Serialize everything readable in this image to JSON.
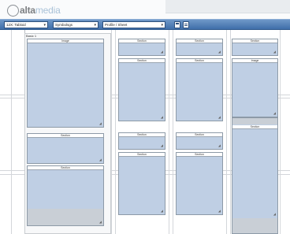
{
  "app": {
    "logo_part1": "alta",
    "logo_part2": "media"
  },
  "toolbar": {
    "dropdowns": [
      {
        "label": "12X: Tabloid"
      },
      {
        "label": "Symbolsgs"
      },
      {
        "label": "Profile / Sheet"
      }
    ],
    "icons": [
      "save-icon",
      "document-icon"
    ]
  },
  "canvas": {
    "page_label": "Basic 1",
    "panels": [
      {
        "title": "Image"
      },
      {
        "title": "Section"
      },
      {
        "title": "Section"
      },
      {
        "title": "Section"
      },
      {
        "title": "Section"
      },
      {
        "title": "Section"
      },
      {
        "title": "Section"
      },
      {
        "title": "Section"
      },
      {
        "title": "Section"
      },
      {
        "title": "Section"
      },
      {
        "title": "Section"
      },
      {
        "title": "Section"
      },
      {
        "title": "Image"
      },
      {
        "title": "Section"
      }
    ]
  },
  "colors": {
    "toolbar": "#4f7db5",
    "panel_fill": "#bfcfe4",
    "panel_border": "#8d9aa7",
    "grid_line": "#d3d6da"
  }
}
